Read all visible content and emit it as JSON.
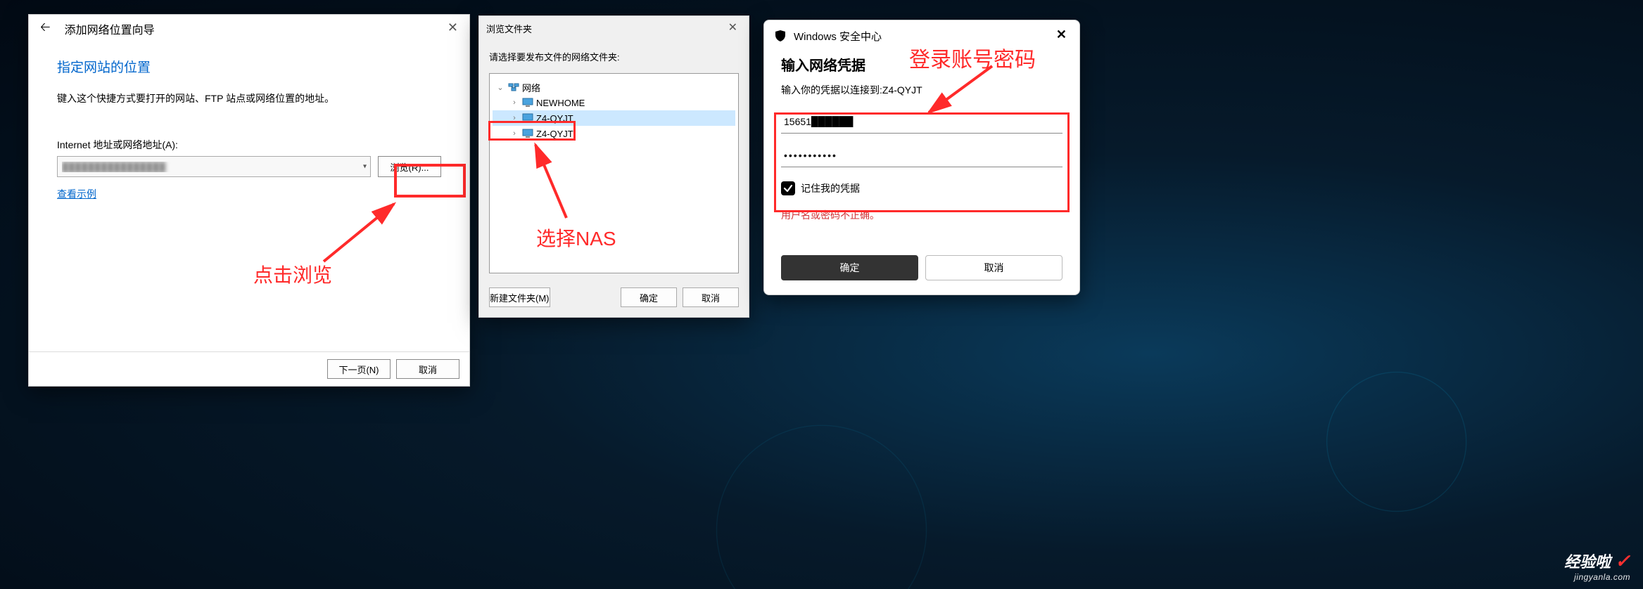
{
  "dlg1": {
    "wizard_title": "添加网络位置向导",
    "heading": "指定网站的位置",
    "desc": "键入这个快捷方式要打开的网站、FTP 站点或网络位置的地址。",
    "address_label": "Internet 地址或网络地址(A):",
    "address_value": "████████████████",
    "browse_btn": "浏览(R)...",
    "example_link": "查看示例",
    "next_btn": "下一页(N)",
    "cancel_btn": "取消"
  },
  "dlg2": {
    "title": "浏览文件夹",
    "prompt": "请选择要发布文件的网络文件夹:",
    "tree": {
      "root": "网络",
      "items": [
        {
          "name": "NEWHOME"
        },
        {
          "name": "Z4-QYJT",
          "selected": true
        },
        {
          "name": "Z4-QYJT"
        }
      ]
    },
    "new_folder_btn": "新建文件夹(M)",
    "ok_btn": "确定",
    "cancel_btn": "取消"
  },
  "dlg3": {
    "title": "Windows 安全中心",
    "heading": "输入网络凭据",
    "subtext": "输入你的凭据以连接到:Z4-QYJT",
    "username_visible": "15651",
    "password_masked": "●●●●●●●●●●●",
    "remember_label": "记住我的凭据",
    "remember_checked": true,
    "error_text": "用户名或密码不正确。",
    "ok_btn": "确定",
    "cancel_btn": "取消"
  },
  "annotations": {
    "browse_hint": "点击浏览",
    "nas_hint": "选择NAS",
    "login_hint": "登录账号密码"
  },
  "watermark": {
    "line1": "经验啦",
    "line2": "jingyanla.com"
  }
}
